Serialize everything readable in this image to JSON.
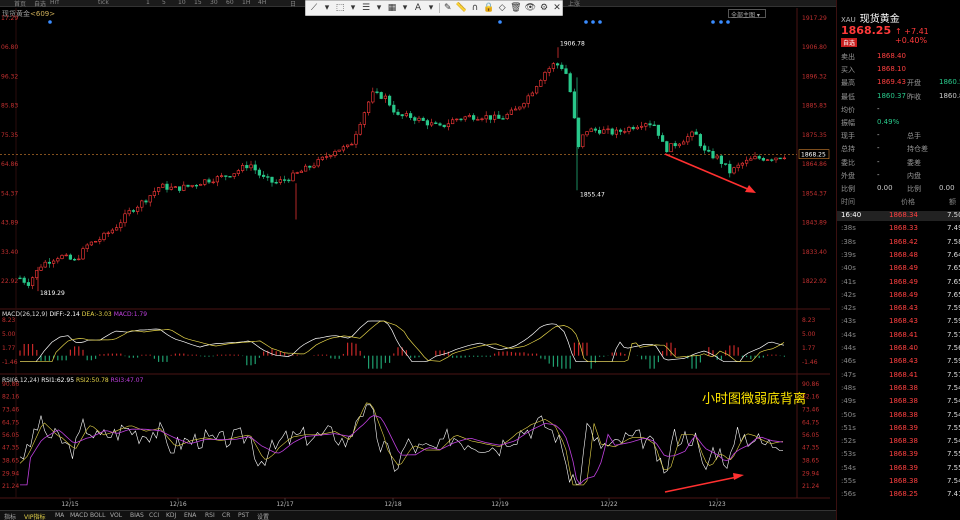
{
  "topbar": {
    "items": [
      "首页",
      "自选",
      "Hrf",
      "tick",
      "1",
      "5",
      "10",
      "15",
      "30",
      "60",
      "1H",
      "4H",
      "日",
      "周",
      "月"
    ],
    "right": "上涨"
  },
  "toolbar": {
    "icons": [
      "line-tool-icon",
      "select-tool-icon",
      "fib-tool-icon",
      "pattern-tool-icon",
      "text-tool-icon",
      "brush-tool-icon",
      "ruler-tool-icon",
      "magnet-icon",
      "lock-icon",
      "eraser-icon",
      "delete-icon",
      "eye-icon",
      "settings-icon",
      "close-icon"
    ]
  },
  "chart": {
    "title": "现货黄金",
    "title_suffix": "<609>",
    "range_box": "全部主图",
    "y_labels": [
      "1917.29",
      "1906.80",
      "1896.32",
      "1885.83",
      "1875.35",
      "1864.86",
      "1854.37",
      "1843.89",
      "1833.40",
      "1822.92"
    ],
    "left_y_labels": [
      "17.29",
      "06.80",
      "96.32",
      "85.83",
      "75.35",
      "64.86",
      "54.37",
      "43.89",
      "33.40",
      "22.92"
    ],
    "x_labels": [
      "12/15",
      "12/16",
      "12/17",
      "12/18",
      "12/19",
      "12/22",
      "12/23"
    ],
    "current_price_tag": "1868.25",
    "annotations": {
      "high": "1906.78",
      "mid_low": "1855.47",
      "low": "1819.29"
    }
  },
  "macd": {
    "label": "MACD(26,12,9)",
    "diff": "DIFF:-2.14",
    "dea": "DEA:-3.03",
    "macd": "MACD:1.79",
    "y_labels": [
      "8.23",
      "5.00",
      "1.77",
      "-1.46"
    ]
  },
  "rsi": {
    "label": "RSI(6,12,24)",
    "rsi1": "RSI1:62.95",
    "rsi2": "RSI2:50.78",
    "rsi3": "RSI3:47.07",
    "y_labels": [
      "90.86",
      "82.16",
      "73.46",
      "64.75",
      "56.05",
      "47.35",
      "38.65",
      "29.94",
      "21.24"
    ]
  },
  "annotation_text": "小时图微弱底背离",
  "bottom_tabs": [
    "指标",
    "VIP指标",
    "MA",
    "MACD",
    "BOLL",
    "VOL",
    "BIAS",
    "CCI",
    "KDJ",
    "ENA",
    "RSI",
    "CR",
    "PST",
    "设置"
  ],
  "quote": {
    "symbol": "XAU",
    "name": "现货黄金",
    "price": "1868.25",
    "change": "↑ +7.41 +0.40%",
    "badge": "自选",
    "rows": [
      {
        "l1": "卖出",
        "v1": "1868.40",
        "l2": "",
        "v2": ""
      },
      {
        "l1": "买入",
        "v1": "1868.10",
        "l2": "",
        "v2": ""
      },
      {
        "l1": "最高",
        "v1": "1869.43",
        "l2": "开盘",
        "v2": "1860.5"
      },
      {
        "l1": "最低",
        "v1": "1860.37",
        "l2": "昨收",
        "v2": "1860.8"
      },
      {
        "l1": "均价",
        "v1": "-",
        "l2": "",
        "v2": ""
      },
      {
        "l1": "振幅",
        "v1": "0.49%",
        "l2": "",
        "v2": ""
      },
      {
        "l1": "现手",
        "v1": "-",
        "l2": "总手",
        "v2": ""
      },
      {
        "l1": "总持",
        "v1": "-",
        "l2": "持仓差",
        "v2": ""
      },
      {
        "l1": "委比",
        "v1": "-",
        "l2": "委差",
        "v2": ""
      },
      {
        "l1": "外盘",
        "v1": "-",
        "l2": "内盘",
        "v2": ""
      },
      {
        "l1": "比例",
        "v1": "0.00",
        "l2": "比例",
        "v2": "0.00"
      }
    ],
    "tick_headers": [
      "时间",
      "价格",
      "额"
    ],
    "ticks": [
      {
        "t": "16:40",
        "p": "1868.34",
        "v": "7.50"
      },
      {
        "t": ":38s",
        "p": "1868.33",
        "v": "7.49"
      },
      {
        "t": ":38s",
        "p": "1868.42",
        "v": "7.58"
      },
      {
        "t": ":39s",
        "p": "1868.48",
        "v": "7.64"
      },
      {
        "t": ":40s",
        "p": "1868.49",
        "v": "7.65"
      },
      {
        "t": ":41s",
        "p": "1868.49",
        "v": "7.65"
      },
      {
        "t": ":42s",
        "p": "1868.49",
        "v": "7.65"
      },
      {
        "t": ":42s",
        "p": "1868.43",
        "v": "7.59"
      },
      {
        "t": ":43s",
        "p": "1868.43",
        "v": "7.59"
      },
      {
        "t": ":44s",
        "p": "1868.41",
        "v": "7.57"
      },
      {
        "t": ":44s",
        "p": "1868.40",
        "v": "7.56"
      },
      {
        "t": ":46s",
        "p": "1868.43",
        "v": "7.59"
      },
      {
        "t": ":47s",
        "p": "1868.41",
        "v": "7.57"
      },
      {
        "t": ":48s",
        "p": "1868.38",
        "v": "7.54"
      },
      {
        "t": ":49s",
        "p": "1868.38",
        "v": "7.54"
      },
      {
        "t": ":50s",
        "p": "1868.38",
        "v": "7.54"
      },
      {
        "t": ":51s",
        "p": "1868.39",
        "v": "7.55"
      },
      {
        "t": ":52s",
        "p": "1868.38",
        "v": "7.54"
      },
      {
        "t": ":53s",
        "p": "1868.39",
        "v": "7.55"
      },
      {
        "t": ":54s",
        "p": "1868.39",
        "v": "7.55"
      },
      {
        "t": ":55s",
        "p": "1868.38",
        "v": "7.54"
      },
      {
        "t": ":56s",
        "p": "1868.25",
        "v": "7.41"
      }
    ]
  },
  "colors": {
    "up": "#ff3a3a",
    "down": "#29c98b",
    "diff": "#ffffff",
    "dea": "#e5d44a",
    "rsi3": "#c040e0",
    "annotation": "#ffe600"
  }
}
